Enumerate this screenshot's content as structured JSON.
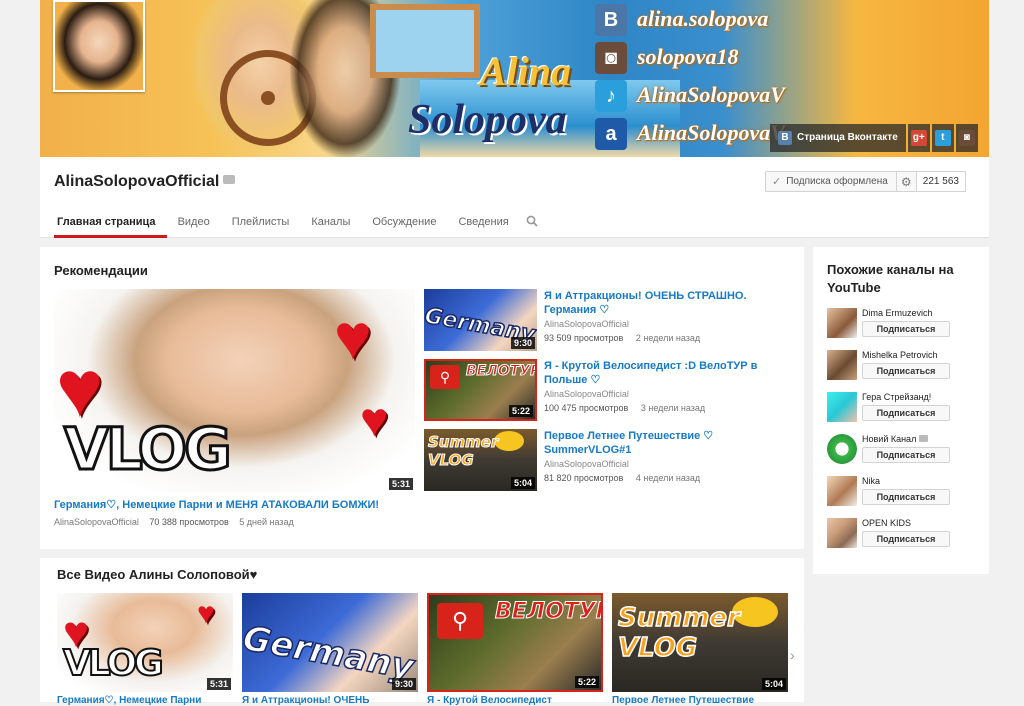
{
  "colors": {
    "accent": "#cc181e",
    "link": "#167ac6",
    "page_bg": "#f1f1f1"
  },
  "banner": {
    "name_first": "Alina",
    "name_last": "Solopova",
    "social": [
      {
        "icon": "vk-icon",
        "glyph": "B",
        "handle": "alina.solopova"
      },
      {
        "icon": "instagram-icon",
        "glyph": "◙",
        "handle": "solopova18"
      },
      {
        "icon": "twitter-icon",
        "glyph": "♪",
        "handle": "AlinaSolopovaV"
      },
      {
        "icon": "ask-fm-icon",
        "glyph": "a",
        "handle": "AlinaSolopovaV"
      }
    ],
    "links": {
      "vk_label": "Страница Вконтакте",
      "vk_glyph": "B",
      "gplus_glyph": "g+",
      "twitter_glyph": "t",
      "instagram_glyph": "◙"
    }
  },
  "channel": {
    "name": "AlinaSolopovaOfficial",
    "subscribe_label": "Подписка оформлена",
    "subscribe_check": "✓",
    "gear_glyph": "⚙",
    "subscriber_count": "221 563"
  },
  "tabs": [
    {
      "label": "Главная страница"
    },
    {
      "label": "Видео"
    },
    {
      "label": "Плейлисты"
    },
    {
      "label": "Каналы"
    },
    {
      "label": "Обсуждение"
    },
    {
      "label": "Сведения"
    }
  ],
  "recommendations": {
    "title": "Рекомендации",
    "featured": {
      "thumb_word": "VLOG",
      "duration": "5:31",
      "title": "Германия♡, Немецкие Парни и МЕНЯ АТАКОВАЛИ БОМЖИ!",
      "channel": "AlinaSolopovaOfficial",
      "views": "70 388 просмотров",
      "ago": "5 дней назад"
    },
    "side": [
      {
        "thumb_word": "Germany",
        "duration": "9:30",
        "title": "Я и Аттракционы! ОЧЕНЬ СТРАШНО. Германия ♡",
        "channel": "AlinaSolopovaOfficial",
        "views": "93 509 просмотров",
        "ago": "2 недели назад"
      },
      {
        "thumb_word": "ВЕЛОТУР",
        "duration": "5:22",
        "title": "Я - Крутой Велосипедист :D ВелоТУР в Польше ♡",
        "channel": "AlinaSolopovaOfficial",
        "views": "100 475 просмотров",
        "ago": "3 недели назад"
      },
      {
        "thumb_word": "Summer VLOG",
        "duration": "5:04",
        "title": "Первое Летнее Путешествие ♡ SummerVLOG#1",
        "channel": "AlinaSolopovaOfficial",
        "views": "81 820 просмотров",
        "ago": "4 недели назад"
      }
    ]
  },
  "all_videos": {
    "title": "Все Видео Алины Солоповой♥",
    "items": [
      {
        "thumb_word": "VLOG",
        "duration": "5:31",
        "title": "Германия♡, Немецкие Парни"
      },
      {
        "thumb_word": "Germany",
        "duration": "9:30",
        "title": "Я и Аттракционы! ОЧЕНЬ"
      },
      {
        "thumb_word": "ВЕЛОТУР",
        "duration": "5:22",
        "title": "Я - Крутой Велосипедист"
      },
      {
        "thumb_word": "Summer VLOG",
        "duration": "5:04",
        "title": "Первое Летнее Путешествие"
      }
    ],
    "next_glyph": "›"
  },
  "related": {
    "title": "Похожие каналы на YouTube",
    "subscribe_label": "Подписаться",
    "channels": [
      {
        "name": "Dima Ermuzevich",
        "verified": false
      },
      {
        "name": "Mishelka Petrovich",
        "verified": false
      },
      {
        "name": "Гера Стрейзанд!",
        "verified": false
      },
      {
        "name": "Новий Канал",
        "verified": true
      },
      {
        "name": "Nika",
        "verified": false
      },
      {
        "name": "OPEN KIDS",
        "verified": false
      }
    ]
  }
}
